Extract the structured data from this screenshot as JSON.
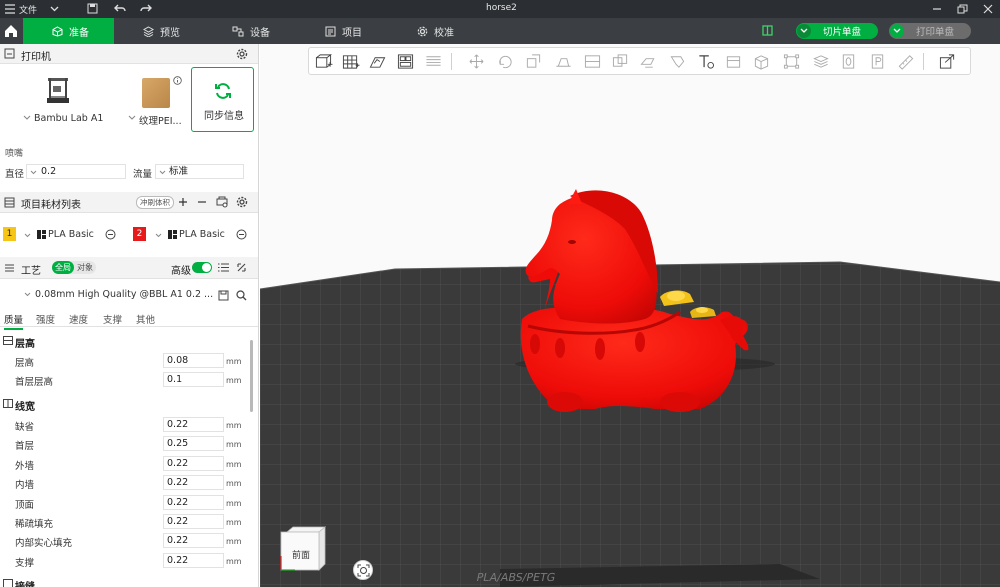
{
  "window": {
    "title": "horse2",
    "file_menu": "文件"
  },
  "tabs": [
    {
      "label": "准备",
      "active": true
    },
    {
      "label": "预览"
    },
    {
      "label": "设备"
    },
    {
      "label": "项目"
    },
    {
      "label": "校准"
    }
  ],
  "actions": {
    "slice": "切片单盘",
    "print": "打印单盘"
  },
  "printer": {
    "section_title": "打印机",
    "name": "Bambu Lab A1",
    "plate": "纹理PEI...",
    "sync": "同步信息",
    "nozzle_title": "喷嘴",
    "diameter_label": "直径",
    "diameter_value": "0.2",
    "flow_label": "流量",
    "flow_value": "标准"
  },
  "filament": {
    "section_title": "项目耗材列表",
    "flush_badge": "冲刷体积",
    "slots": [
      {
        "index": "1",
        "name": "PLA Basic",
        "color": "#f5c518"
      },
      {
        "index": "2",
        "name": "PLA Basic",
        "color": "#e8191b"
      }
    ]
  },
  "process": {
    "section_title": "工艺",
    "toggle_global": "全局",
    "toggle_object": "对象",
    "advanced_label": "高级",
    "preset": "0.08mm High Quality @BBL A1 0.2 ...",
    "subtabs": [
      "质量",
      "强度",
      "速度",
      "支撑",
      "其他"
    ],
    "groups": {
      "layer_height": "层高",
      "line_width": "线宽",
      "seam": "接缝"
    },
    "layer_rows": [
      {
        "label": "层高",
        "value": "0.08",
        "unit": "mm"
      },
      {
        "label": "首层层高",
        "value": "0.1",
        "unit": "mm"
      }
    ],
    "width_rows": [
      {
        "label": "缺省",
        "value": "0.22",
        "unit": "mm"
      },
      {
        "label": "首层",
        "value": "0.25",
        "unit": "mm"
      },
      {
        "label": "外墙",
        "value": "0.22",
        "unit": "mm"
      },
      {
        "label": "内墙",
        "value": "0.22",
        "unit": "mm"
      },
      {
        "label": "顶面",
        "value": "0.22",
        "unit": "mm"
      },
      {
        "label": "稀疏填充",
        "value": "0.22",
        "unit": "mm"
      },
      {
        "label": "内部实心填充",
        "value": "0.22",
        "unit": "mm"
      },
      {
        "label": "支撑",
        "value": "0.22",
        "unit": "mm"
      }
    ]
  },
  "viewport": {
    "view_cube_label": "前面",
    "plate_text": "PLA/ABS/PETG"
  },
  "colors": {
    "accent": "#00ae42",
    "titlebar": "#2b2f33",
    "toolbar": "#3b3f44",
    "model": "#f20d0d",
    "ingot": "#f2c21b",
    "bed": "#3e3e3e"
  }
}
